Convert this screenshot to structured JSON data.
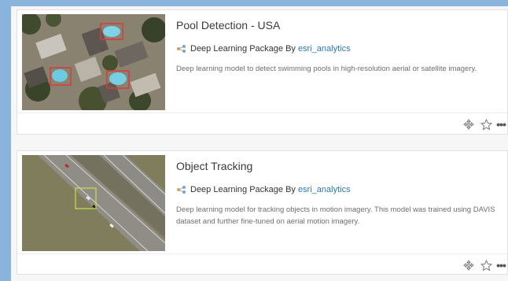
{
  "items": [
    {
      "title": "Pool Detection - USA",
      "type_label": "Deep Learning Package By",
      "owner": "esri_analytics",
      "description": "Deep learning model to detect swimming pools in high-resolution aerial or satellite imagery.",
      "thumbnail_icon": "aerial-pools-thumbnail"
    },
    {
      "title": "Object Tracking",
      "type_label": "Deep Learning Package By",
      "owner": "esri_analytics",
      "description": "Deep learning model for tracking objects in motion imagery. This model was trained using DAVIS dataset and further fine-tuned on aerial motion imagery.",
      "thumbnail_icon": "highway-tracking-thumbnail"
    }
  ],
  "actions": {
    "move_icon": "move-icon",
    "favorite_icon": "star-icon",
    "more_label": "•••"
  },
  "colors": {
    "background": "#8ab4dc",
    "link": "#2b78b8",
    "detection_box": "#d93a3a",
    "tracking_box": "#c8e04a"
  }
}
